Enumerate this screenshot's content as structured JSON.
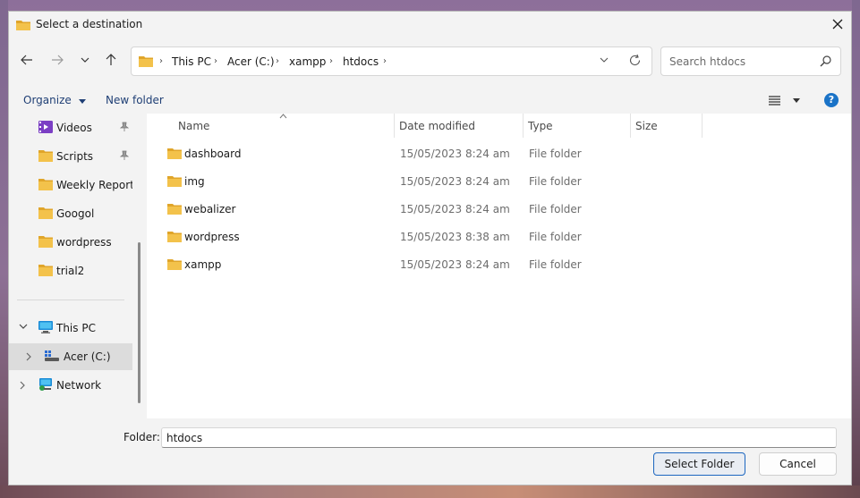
{
  "window": {
    "title": "Select a destination"
  },
  "address": {
    "crumbs": [
      "This PC",
      "Acer (C:)",
      "xampp",
      "htdocs"
    ]
  },
  "search": {
    "placeholder": "Search htdocs"
  },
  "toolbar": {
    "organize_label": "Organize",
    "new_folder_label": "New folder"
  },
  "help_icon_glyph": "?",
  "nav": {
    "items": [
      {
        "label": "Videos",
        "icon": "videos-icon",
        "pinned": true
      },
      {
        "label": "Scripts",
        "icon": "folder-icon",
        "pinned": true
      },
      {
        "label": "Weekly Reportin",
        "icon": "folder-icon",
        "pinned": false
      },
      {
        "label": "Googol",
        "icon": "folder-icon",
        "pinned": false
      },
      {
        "label": "wordpress",
        "icon": "folder-icon",
        "pinned": false
      },
      {
        "label": "trial2",
        "icon": "folder-icon",
        "pinned": false
      }
    ],
    "this_pc": "This PC",
    "drive": "Acer (C:)",
    "network": "Network"
  },
  "columns": [
    "Name",
    "Date modified",
    "Type",
    "Size"
  ],
  "files": [
    {
      "name": "dashboard",
      "date": "15/05/2023 8:24 am",
      "type": "File folder"
    },
    {
      "name": "img",
      "date": "15/05/2023 8:24 am",
      "type": "File folder"
    },
    {
      "name": "webalizer",
      "date": "15/05/2023 8:24 am",
      "type": "File folder"
    },
    {
      "name": "wordpress",
      "date": "15/05/2023 8:38 am",
      "type": "File folder"
    },
    {
      "name": "xampp",
      "date": "15/05/2023 8:24 am",
      "type": "File folder"
    }
  ],
  "footer": {
    "folder_label": "Folder:",
    "folder_value": "htdocs",
    "select_label": "Select Folder",
    "cancel_label": "Cancel"
  },
  "colors": {
    "folder": "#f3c24b",
    "folder_dark": "#e0a52a",
    "accent": "#1c66c0",
    "link": "#1f3f75"
  }
}
